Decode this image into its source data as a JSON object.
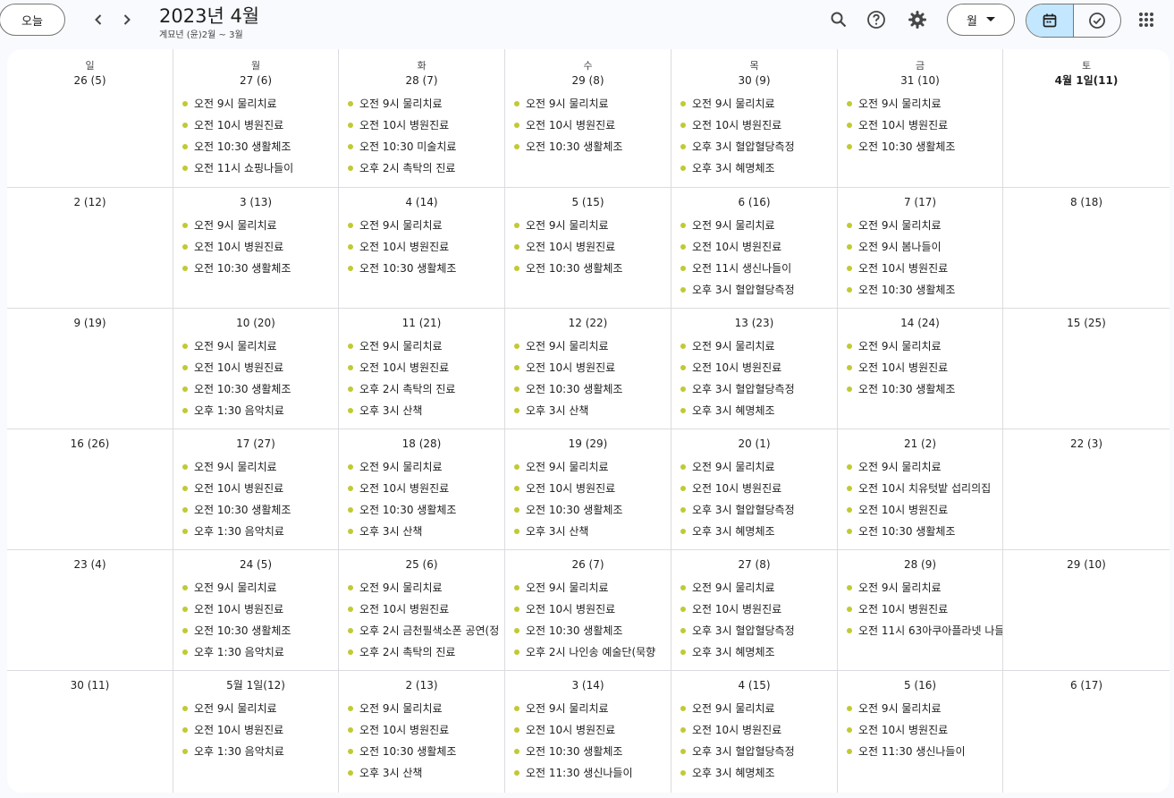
{
  "header": {
    "today_label": "오늘",
    "title": "2023년 4월",
    "subtitle": "계묘년 (윤)2월 ~ 3월",
    "view_label": "월",
    "icons": {
      "prev": "chevron-left-icon",
      "next": "chevron-right-icon",
      "search": "search-icon",
      "help": "help-icon",
      "settings": "gear-icon",
      "calendar": "calendar-icon",
      "tasks": "check-circle-icon",
      "apps": "apps-grid-icon"
    }
  },
  "colors": {
    "accent": "#c2e7ff",
    "event_dot": "#c0ca33"
  },
  "weekdays": [
    "일",
    "월",
    "화",
    "수",
    "목",
    "금",
    "토"
  ],
  "weeks": [
    {
      "days": [
        {
          "label": "26 (5)",
          "events": []
        },
        {
          "label": "27 (6)",
          "events": [
            "오전 9시 물리치료",
            "오전 10시 병원진료",
            "오전 10:30 생활체조",
            "오전 11시 쇼핑나들이"
          ]
        },
        {
          "label": "28 (7)",
          "events": [
            "오전 9시 물리치료",
            "오전 10시 병원진료",
            "오전 10:30 미술치료",
            "오후 2시 촉탁의 진료"
          ]
        },
        {
          "label": "29 (8)",
          "events": [
            "오전 9시 물리치료",
            "오전 10시 병원진료",
            "오전 10:30 생활체조"
          ]
        },
        {
          "label": "30 (9)",
          "events": [
            "오전 9시 물리치료",
            "오전 10시 병원진료",
            "오후 3시 혈압혈당측정",
            "오후 3시 혜명체조"
          ]
        },
        {
          "label": "31 (10)",
          "events": [
            "오전 9시 물리치료",
            "오전 10시 병원진료",
            "오전 10:30 생활체조"
          ]
        },
        {
          "label": "4월 1일(11)",
          "bold": true,
          "events": []
        }
      ]
    },
    {
      "days": [
        {
          "label": "2 (12)",
          "events": []
        },
        {
          "label": "3 (13)",
          "events": [
            "오전 9시 물리치료",
            "오전 10시 병원진료",
            "오전 10:30 생활체조"
          ]
        },
        {
          "label": "4 (14)",
          "events": [
            "오전 9시 물리치료",
            "오전 10시 병원진료",
            "오전 10:30 생활체조"
          ]
        },
        {
          "label": "5 (15)",
          "events": [
            "오전 9시 물리치료",
            "오전 10시 병원진료",
            "오전 10:30 생활체조"
          ]
        },
        {
          "label": "6 (16)",
          "events": [
            "오전 9시 물리치료",
            "오전 10시 병원진료",
            "오전 11시 생신나들이",
            "오후 3시 혈압혈당측정"
          ]
        },
        {
          "label": "7 (17)",
          "events": [
            "오전 9시 물리치료",
            "오전 9시 봄나들이",
            "오전 10시 병원진료",
            "오전 10:30 생활체조"
          ]
        },
        {
          "label": "8 (18)",
          "events": []
        }
      ]
    },
    {
      "days": [
        {
          "label": "9 (19)",
          "events": []
        },
        {
          "label": "10 (20)",
          "events": [
            "오전 9시 물리치료",
            "오전 10시 병원진료",
            "오전 10:30 생활체조",
            "오후 1:30 음악치료"
          ]
        },
        {
          "label": "11 (21)",
          "events": [
            "오전 9시 물리치료",
            "오전 10시 병원진료",
            "오후 2시 촉탁의 진료",
            "오후 3시 산책"
          ]
        },
        {
          "label": "12 (22)",
          "events": [
            "오전 9시 물리치료",
            "오전 10시 병원진료",
            "오전 10:30 생활체조",
            "오후 3시 산책"
          ]
        },
        {
          "label": "13 (23)",
          "events": [
            "오전 9시 물리치료",
            "오전 10시 병원진료",
            "오후 3시 혈압혈당측정",
            "오후 3시 혜명체조"
          ]
        },
        {
          "label": "14 (24)",
          "events": [
            "오전 9시 물리치료",
            "오전 10시 병원진료",
            "오전 10:30 생활체조"
          ]
        },
        {
          "label": "15 (25)",
          "events": []
        }
      ]
    },
    {
      "days": [
        {
          "label": "16 (26)",
          "events": []
        },
        {
          "label": "17 (27)",
          "events": [
            "오전 9시 물리치료",
            "오전 10시 병원진료",
            "오전 10:30 생활체조",
            "오후 1:30 음악치료"
          ]
        },
        {
          "label": "18 (28)",
          "events": [
            "오전 9시 물리치료",
            "오전 10시 병원진료",
            "오전 10:30 생활체조",
            "오후 3시 산책"
          ]
        },
        {
          "label": "19 (29)",
          "events": [
            "오전 9시 물리치료",
            "오전 10시 병원진료",
            "오전 10:30 생활체조",
            "오후 3시 산책"
          ]
        },
        {
          "label": "20 (1)",
          "events": [
            "오전 9시 물리치료",
            "오전 10시 병원진료",
            "오후 3시 혈압혈당측정",
            "오후 3시 혜명체조"
          ]
        },
        {
          "label": "21 (2)",
          "events": [
            "오전 9시 물리치료",
            "오전 10시 치유텃밭 섭리의집",
            "오전 10시 병원진료",
            "오전 10:30 생활체조"
          ]
        },
        {
          "label": "22 (3)",
          "events": []
        }
      ]
    },
    {
      "days": [
        {
          "label": "23 (4)",
          "events": []
        },
        {
          "label": "24 (5)",
          "events": [
            "오전 9시 물리치료",
            "오전 10시 병원진료",
            "오전 10:30 생활체조",
            "오후 1:30 음악치료"
          ]
        },
        {
          "label": "25 (6)",
          "events": [
            "오전 9시 물리치료",
            "오전 10시 병원진료",
            "오후 2시 금천필색소폰 공연(정",
            "오후 2시 촉탁의 진료"
          ]
        },
        {
          "label": "26 (7)",
          "events": [
            "오전 9시 물리치료",
            "오전 10시 병원진료",
            "오전 10:30 생활체조",
            "오후 2시 나인송 예술단(묵향"
          ]
        },
        {
          "label": "27 (8)",
          "events": [
            "오전 9시 물리치료",
            "오전 10시 병원진료",
            "오후 3시 혈압혈당측정",
            "오후 3시 혜명체조"
          ]
        },
        {
          "label": "28 (9)",
          "events": [
            "오전 9시 물리치료",
            "오전 10시 병원진료",
            "오전 11시 63아쿠아플라넷 나들"
          ]
        },
        {
          "label": "29 (10)",
          "events": []
        }
      ]
    },
    {
      "days": [
        {
          "label": "30 (11)",
          "events": []
        },
        {
          "label": "5월 1일(12)",
          "events": [
            "오전 9시 물리치료",
            "오전 10시 병원진료",
            "오후 1:30 음악치료"
          ]
        },
        {
          "label": "2 (13)",
          "events": [
            "오전 9시 물리치료",
            "오전 10시 병원진료",
            "오전 10:30 생활체조",
            "오후 3시 산책"
          ]
        },
        {
          "label": "3 (14)",
          "events": [
            "오전 9시 물리치료",
            "오전 10시 병원진료",
            "오전 10:30 생활체조",
            "오전 11:30 생신나들이"
          ]
        },
        {
          "label": "4 (15)",
          "events": [
            "오전 9시 물리치료",
            "오전 10시 병원진료",
            "오후 3시 혈압혈당측정",
            "오후 3시 혜명체조"
          ]
        },
        {
          "label": "5 (16)",
          "events": [
            "오전 9시 물리치료",
            "오전 10시 병원진료",
            "오전 11:30 생신나들이"
          ]
        },
        {
          "label": "6 (17)",
          "events": []
        }
      ]
    }
  ]
}
